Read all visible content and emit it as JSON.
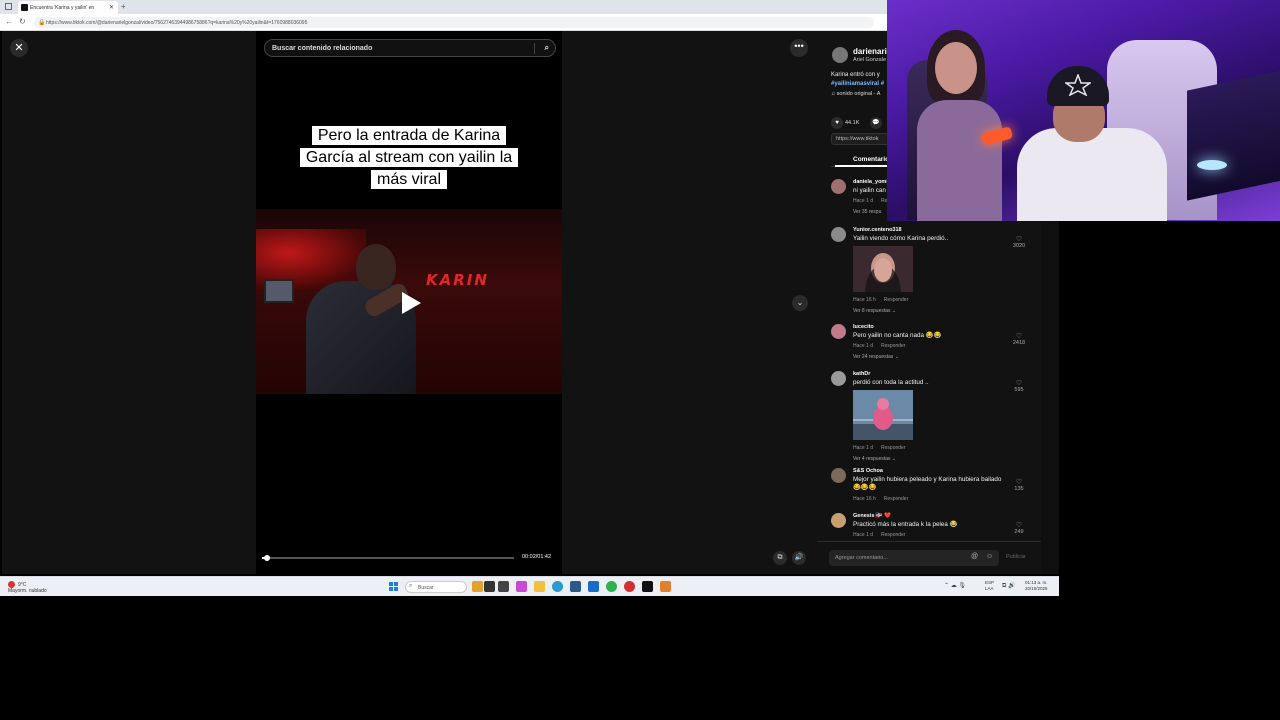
{
  "browser": {
    "tab_title": "Encuentra 'Karina y yailin' en",
    "new_tab": "+",
    "url": "https://www.tiktok.com/@darienarielgonzal/video/7562746394498675886?q=karina%20y%20yailin&t=1760988036095"
  },
  "viewer": {
    "close_icon": "✕",
    "more_icon": "•••",
    "search_placeholder": "Buscar contenido relacionado",
    "caption": "Pero la entrada de Karina García al stream con yailin la más viral",
    "brand_text": "KARIN",
    "time": "00:02/01:42",
    "progress": 0.02
  },
  "panel": {
    "author": "darienario",
    "author_sub": "Ariel Gonzale",
    "description": "Karina entró con y",
    "hashtag": "#yailiniamasviral #",
    "sound": "♫ sonido original - A",
    "likes": "44.1K",
    "link": "https://www.tiktok",
    "tab_comments": "Comentarios",
    "comments": [
      {
        "user": "daniela_yomi",
        "text": "ni yailin can",
        "time": "Hace 1 d",
        "reply": "Re",
        "replies": "Ver 35 respu",
        "likes": ""
      },
      {
        "user": "Yunior.centeno318",
        "text": "Yailin viendo cómo Karina perdió..",
        "time": "Hace 16 h",
        "reply": "Responder",
        "replies": "Ver 8 respuestas ⌄",
        "likes": "3020"
      },
      {
        "user": "lucecito",
        "text": "Pero yailin no canta nada 😂😂",
        "time": "Hace 1 d",
        "reply": "Responder",
        "replies": "Ver 24 respuestas ⌄",
        "likes": "2418"
      },
      {
        "user": "kathDr",
        "text": "perdió con toda la actitud ..",
        "time": "Hace 1 d",
        "reply": "Responder",
        "replies": "Ver 4 respuestas ⌄",
        "likes": "595"
      },
      {
        "user": "S&S Ochoa",
        "text": "Mejor yailin hubiera peleado y Karina hubiera bailado 😂😂😂",
        "time": "Hace 16 h",
        "reply": "Responder",
        "replies": "",
        "likes": "135"
      },
      {
        "user": "Genesis 🇩🇴 ❤️",
        "text": "Practicó más la entrada k la pelea 😂",
        "time": "Hace 1 d",
        "reply": "Responder",
        "replies": "",
        "likes": "249"
      }
    ],
    "comment_placeholder": "Agregar comentario...",
    "publish": "Publicar"
  },
  "taskbar": {
    "weather_temp": "9°C",
    "weather_desc": "Mayorm. nublado",
    "search": "Buscar",
    "lang_1": "ESP",
    "lang_2": "LAA",
    "clock_time": "01:13 a. m.",
    "clock_date": "20/10/2025"
  },
  "colors": {
    "accent_red": "#e3242b",
    "hashtag_blue": "#7fb8ff",
    "webcam_purple": "#6b2fc9"
  }
}
